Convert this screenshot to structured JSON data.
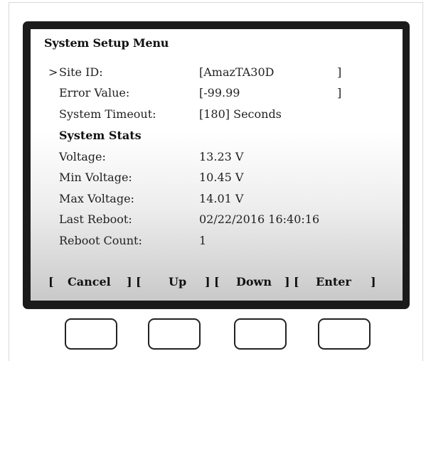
{
  "menu": {
    "title": "System Setup Menu",
    "cursor": ">",
    "rows": [
      {
        "label": "Site ID:",
        "value": "[AmazTA30D",
        "close": "]"
      },
      {
        "label": "Error Value:",
        "value": "[-99.99",
        "close": "]"
      },
      {
        "label": "System Timeout:",
        "value": "[180] Seconds",
        "close": ""
      }
    ],
    "stats_heading": "System Stats",
    "stats": [
      {
        "label": "Voltage:",
        "value": "13.23 V"
      },
      {
        "label": "Min Voltage:",
        "value": "10.45 V"
      },
      {
        "label": "Max Voltage:",
        "value": "14.01 V"
      },
      {
        "label": "Last Reboot:",
        "value": "02/22/2016  16:40:16"
      },
      {
        "label": "Reboot Count:",
        "value": "1"
      }
    ]
  },
  "softkeys": {
    "text": "[  Cancel  ] [     Up     ] [   Down   ] [   Enter   ]",
    "labels": [
      "Cancel",
      "Up",
      "Down",
      "Enter"
    ]
  }
}
